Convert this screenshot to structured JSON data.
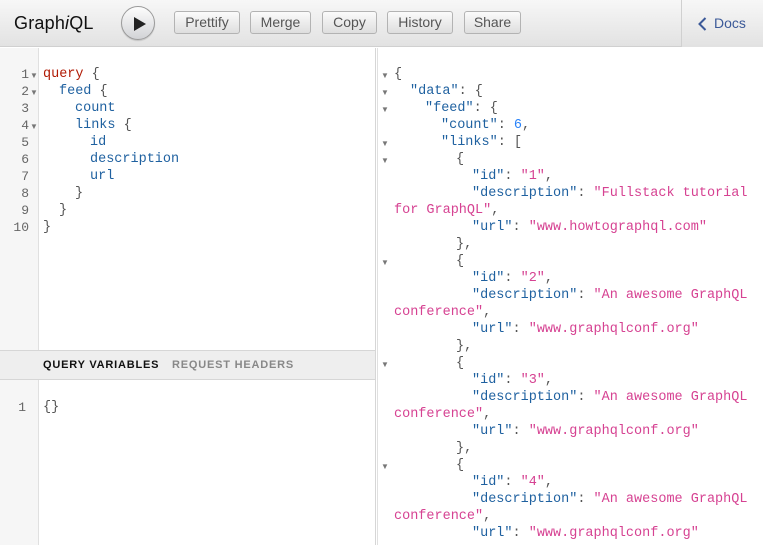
{
  "topbar": {
    "logo_pre": "Graph",
    "logo_i": "i",
    "logo_post": "QL",
    "buttons": [
      "Prettify",
      "Merge",
      "Copy",
      "History",
      "Share"
    ],
    "docs_label": "Docs"
  },
  "query_editor": {
    "line_numbers": [
      "1",
      "2",
      "3",
      "4",
      "5",
      "6",
      "7",
      "8",
      "9",
      "10"
    ],
    "lines": {
      "l1_kw": "query",
      "l1_p": " {",
      "l2_f": "feed",
      "l2_p": " {",
      "l3_f": "count",
      "l4_f": "links",
      "l4_p": " {",
      "l5_f": "id",
      "l6_f": "description",
      "l7_f": "url",
      "l8_p": "}",
      "l9_p": "}",
      "l10_p": "}"
    }
  },
  "variables": {
    "tab_query_variables": "QUERY VARIABLES",
    "tab_request_headers": "REQUEST HEADERS",
    "line_number": "1",
    "value": "{}"
  },
  "result": {
    "open": "{",
    "data_key": "\"data\"",
    "feed_key": "\"feed\"",
    "count_key": "\"count\"",
    "count_value": "6",
    "links_key": "\"links\"",
    "id_key": "\"id\"",
    "description_key": "\"description\"",
    "url_key": "\"url\"",
    "items": [
      {
        "id": "\"1\"",
        "desc_a": "\"Fullstack tutorial",
        "desc_b": "for GraphQL\"",
        "url": "\"www.howtographql.com\""
      },
      {
        "id": "\"2\"",
        "desc_a": "\"An awesome GraphQL",
        "desc_b": "conference\"",
        "url": "\"www.graphqlconf.org\""
      },
      {
        "id": "\"3\"",
        "desc_a": "\"An awesome GraphQL",
        "desc_b": "conference\"",
        "url": "\"www.graphqlconf.org\""
      },
      {
        "id": "\"4\"",
        "desc_a": "\"An awesome GraphQL",
        "desc_b": "conference\"",
        "url": "\"www.graphqlconf.org\""
      }
    ]
  }
}
